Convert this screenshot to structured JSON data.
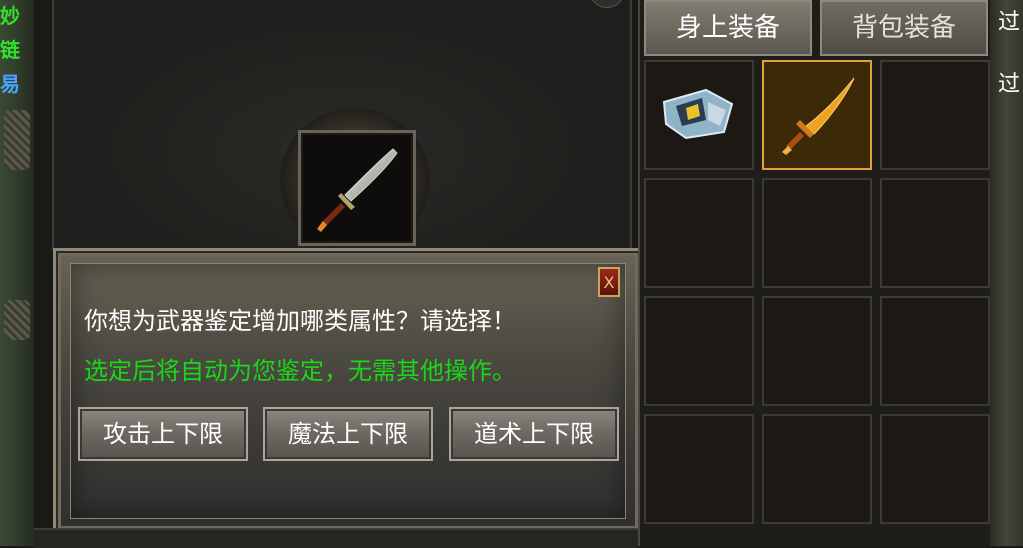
{
  "left_edge": {
    "labels": [
      "妙",
      "链",
      "易"
    ],
    "colors": [
      "#31e02b",
      "#31e02b",
      "#4aa3ff"
    ]
  },
  "right_edge": {
    "labels": [
      "过",
      "过"
    ]
  },
  "weapon_slot": {
    "icon": "broadsword-icon"
  },
  "dialog": {
    "question": "你想为武器鉴定增加哪类属性？请选择！",
    "hint": "选定后将自动为您鉴定，无需其他操作。",
    "close_label": "X",
    "options": [
      {
        "label": "攻击上下限"
      },
      {
        "label": "魔法上下限"
      },
      {
        "label": "道术上下限"
      }
    ]
  },
  "equipment": {
    "tabs": [
      {
        "label": "身上装备",
        "active": true
      },
      {
        "label": "背包装备",
        "active": false
      }
    ],
    "slots": [
      {
        "icon": "gauntlet-icon",
        "selected": false
      },
      {
        "icon": "golden-blade-icon",
        "selected": true
      },
      {
        "icon": "",
        "selected": false
      },
      {
        "icon": "",
        "selected": false
      },
      {
        "icon": "",
        "selected": false
      },
      {
        "icon": "",
        "selected": false
      },
      {
        "icon": "",
        "selected": false
      },
      {
        "icon": "",
        "selected": false
      },
      {
        "icon": "",
        "selected": false
      },
      {
        "icon": "",
        "selected": false
      },
      {
        "icon": "",
        "selected": false
      },
      {
        "icon": "",
        "selected": false
      }
    ]
  },
  "colors": {
    "question_text": "#ffffff",
    "hint_text": "#18d818",
    "selected_border": "#e0a23a"
  }
}
